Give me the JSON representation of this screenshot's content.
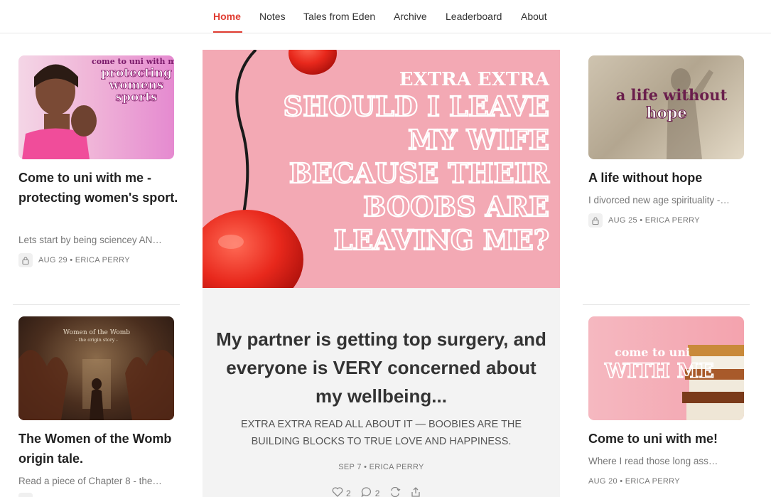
{
  "nav": {
    "items": [
      {
        "label": "Home",
        "active": true
      },
      {
        "label": "Notes"
      },
      {
        "label": "Tales from Eden"
      },
      {
        "label": "Archive"
      },
      {
        "label": "Leaderboard"
      },
      {
        "label": "About"
      }
    ]
  },
  "posts": {
    "left1": {
      "thumb_text": [
        "come to uni with me",
        "protecting",
        "womens",
        "sports"
      ],
      "title": "Come to uni with me - protecting women's sport.",
      "subtitle": "Lets start by being sciencey AN…",
      "meta": "AUG 29 • ERICA PERRY"
    },
    "left2": {
      "thumb_text": [
        "Women of the Womb",
        "- the origin story -"
      ],
      "title": "The Women of the Womb origin tale.",
      "subtitle": "Read a piece of Chapter 8 - the…"
    },
    "right1": {
      "thumb_text": [
        "a life without",
        "hope"
      ],
      "title": "A life without hope",
      "subtitle": "I divorced new age spirituality -…",
      "meta": "AUG 25 • ERICA PERRY"
    },
    "right2": {
      "thumb_text": [
        "come to uni",
        "WITH ME"
      ],
      "title": "Come to uni with me!",
      "subtitle": "Where I read those long ass…",
      "meta": "AUG 20 • ERICA PERRY"
    }
  },
  "featured": {
    "image_text": [
      "EXTRA EXTRA",
      "SHOULD I LEAVE",
      "MY WIFE",
      "BECAUSE THEIR",
      "BOOBS ARE",
      "LEAVING ME?"
    ],
    "title": "My partner is getting top surgery, and everyone is VERY concerned about my wellbeing...",
    "subtitle": "EXTRA EXTRA READ ALL ABOUT IT — BOOBIES ARE THE BUILDING BLOCKS TO TRUE LOVE AND HAPPINESS.",
    "meta": "SEP 7 • ERICA PERRY",
    "likes": "2",
    "comments": "2"
  },
  "icons": [
    "lock-icon",
    "heart-icon",
    "comment-icon",
    "restack-icon",
    "share-icon"
  ],
  "colors": {
    "accent": "#e03c31",
    "featured_bg": "#f3f3f3",
    "featured_pink": "#f3a8b2"
  }
}
